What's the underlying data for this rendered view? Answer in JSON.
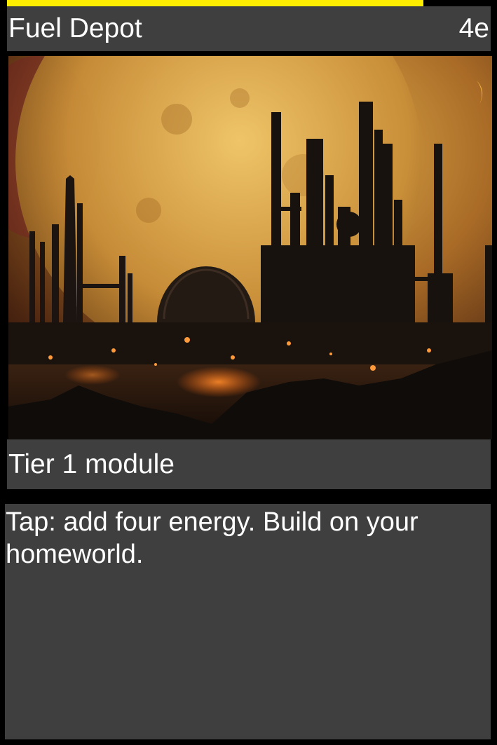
{
  "card": {
    "name": "Fuel Depot",
    "cost": "4e",
    "type_line": "Tier 1 module",
    "rules_text": "Tap: add four energy. Build on your homeworld.",
    "art_icon": "industrial-refinery-planet-art"
  },
  "colors": {
    "accent_bar": "#ffee00",
    "panel": "#3f3f3f",
    "text": "#ffffff",
    "background": "#000000"
  }
}
